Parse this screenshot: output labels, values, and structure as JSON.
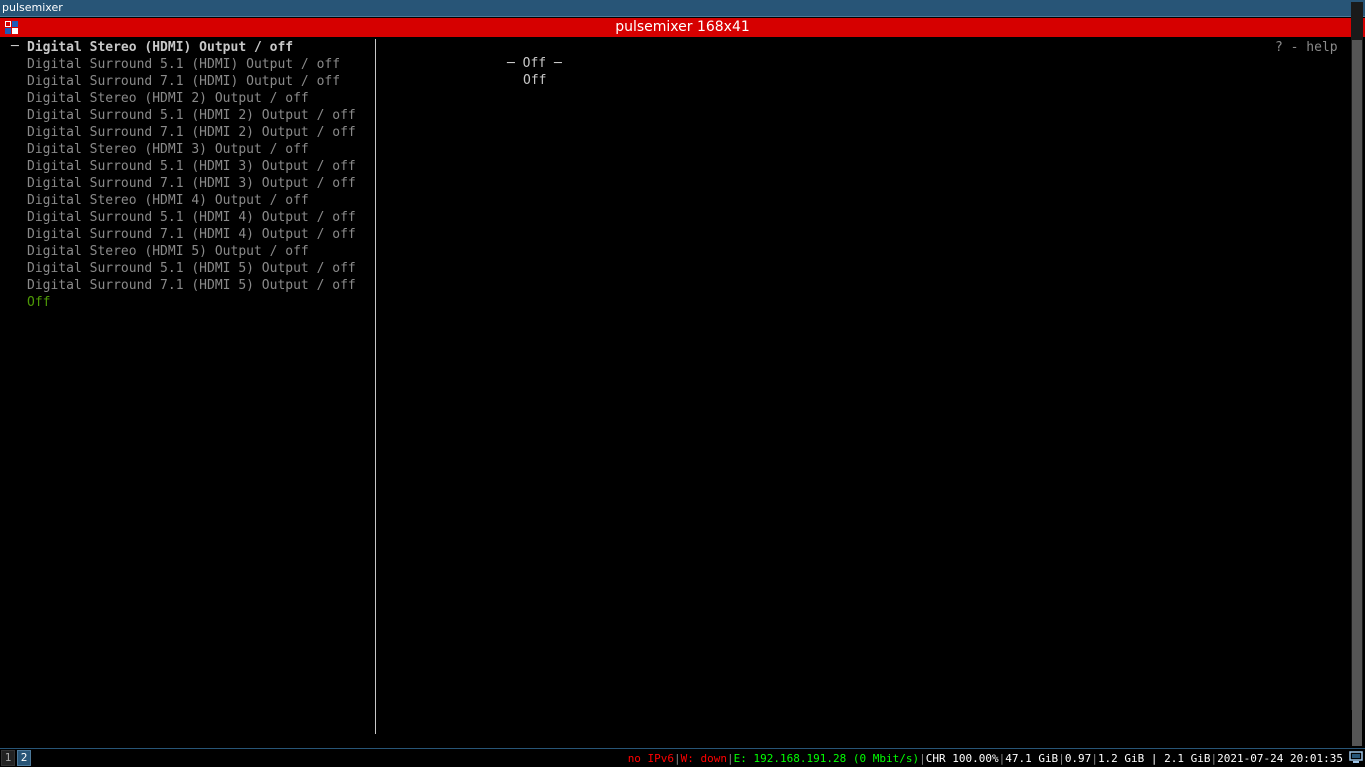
{
  "window": {
    "i3_title": "pulsemixer",
    "title": "pulsemixer 168x41"
  },
  "left_panel": {
    "items": [
      {
        "label": "Digital Stereo (HDMI) Output / off",
        "state": "selected"
      },
      {
        "label": "Digital Surround 5.1 (HDMI) Output / off",
        "state": "normal"
      },
      {
        "label": "Digital Surround 7.1 (HDMI) Output / off",
        "state": "normal"
      },
      {
        "label": "Digital Stereo (HDMI 2) Output / off",
        "state": "normal"
      },
      {
        "label": "Digital Surround 5.1 (HDMI 2) Output / off",
        "state": "normal"
      },
      {
        "label": "Digital Surround 7.1 (HDMI 2) Output / off",
        "state": "normal"
      },
      {
        "label": "Digital Stereo (HDMI 3) Output / off",
        "state": "normal"
      },
      {
        "label": "Digital Surround 5.1 (HDMI 3) Output / off",
        "state": "normal"
      },
      {
        "label": "Digital Surround 7.1 (HDMI 3) Output / off",
        "state": "normal"
      },
      {
        "label": "Digital Stereo (HDMI 4) Output / off",
        "state": "normal"
      },
      {
        "label": "Digital Surround 5.1 (HDMI 4) Output / off",
        "state": "normal"
      },
      {
        "label": "Digital Surround 7.1 (HDMI 4) Output / off",
        "state": "normal"
      },
      {
        "label": "Digital Stereo (HDMI 5) Output / off",
        "state": "normal"
      },
      {
        "label": "Digital Surround 5.1 (HDMI 5) Output / off",
        "state": "normal"
      },
      {
        "label": "Digital Surround 7.1 (HDMI 5) Output / off",
        "state": "normal"
      },
      {
        "label": "Off",
        "state": "active"
      }
    ],
    "selection_marker": "─"
  },
  "right_panel": {
    "help": "? - help",
    "profile_header": "─ Off ─",
    "profile_value": "Off"
  },
  "statusbar": {
    "workspaces": [
      {
        "label": "1",
        "focused": false
      },
      {
        "label": "2",
        "focused": true
      }
    ],
    "ipv6": "no IPv6",
    "wifi": "W: down",
    "ethernet": "E: 192.168.191.28 (0 Mbit/s)",
    "battery": "CHR 100.00%",
    "disk": "47.1 GiB",
    "load": "0.97",
    "memory": "1.2 GiB | 2.1 GiB",
    "datetime": "2021-07-24 20:01:35",
    "separator": "|"
  },
  "colors": {
    "titlebar": "#d60000",
    "i3_bar": "#285577",
    "selected_text": "#c8c8c8",
    "dim_text": "#8a8a8a",
    "active_green": "#4e9a06",
    "status_red": "#ff0000",
    "status_green": "#00ff00"
  }
}
